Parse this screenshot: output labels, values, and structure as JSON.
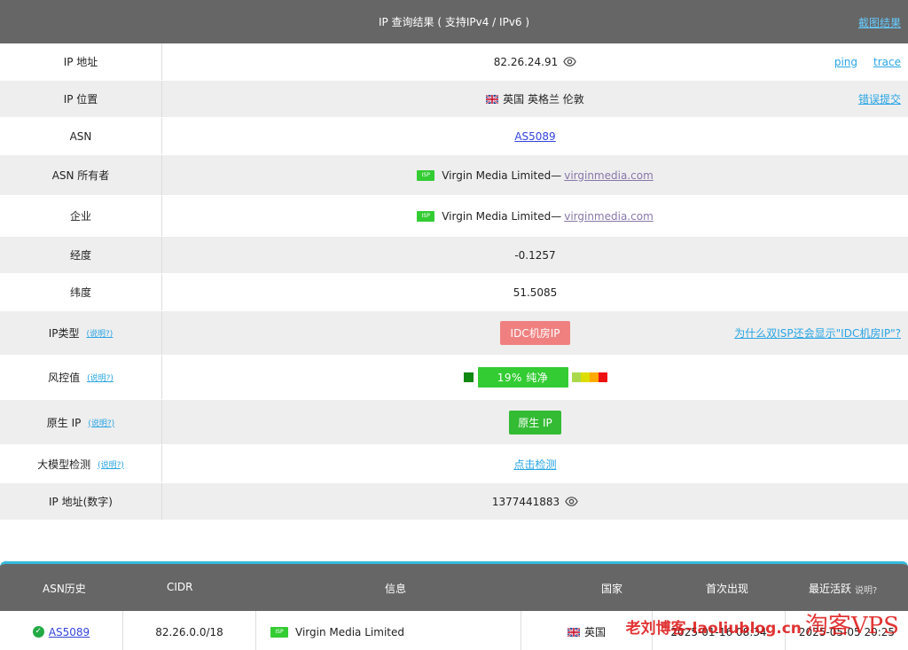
{
  "header": {
    "title": "IP 查询结果 ( 支持IPv4 / IPv6 )",
    "screenshot_link": "截图结果"
  },
  "rows": {
    "ip": {
      "label": "IP 地址",
      "value": "82.26.24.91",
      "ping": "ping",
      "trace": "trace"
    },
    "location": {
      "label": "IP 位置",
      "value": "英国 英格兰 伦敦",
      "report": "错误提交"
    },
    "asn": {
      "label": "ASN",
      "value": "AS5089"
    },
    "asn_owner": {
      "label": "ASN 所有者",
      "badge": "ISP",
      "name": "Virgin Media Limited—",
      "domain": "virginmedia.com"
    },
    "enterprise": {
      "label": "企业",
      "badge": "ISP",
      "name": "Virgin Media Limited—",
      "domain": "virginmedia.com"
    },
    "longitude": {
      "label": "经度",
      "value": "-0.1257"
    },
    "latitude": {
      "label": "纬度",
      "value": "51.5085"
    },
    "ip_type": {
      "label": "IP类型",
      "help": "(说明?)",
      "value": "IDC机房IP",
      "why": "为什么双ISP还会显示\"IDC机房IP\"?"
    },
    "risk": {
      "label": "风控值",
      "help": "(说明?)",
      "value": "19%  纯净",
      "percent": 19
    },
    "native": {
      "label": "原生 IP",
      "help": "(说明?)",
      "value": "原生 IP"
    },
    "llm": {
      "label": "大模型检测",
      "help": "(说明?)",
      "value": "点击检测"
    },
    "ip_numeric": {
      "label": "IP 地址(数字)",
      "value": "1377441883"
    }
  },
  "history": {
    "columns": {
      "asn": "ASN历史",
      "cidr": "CIDR",
      "info": "信息",
      "country": "国家",
      "first": "首次出现",
      "last": "最近活跃",
      "last_help": "说明?"
    },
    "row": {
      "asn": "AS5089",
      "cidr": "82.26.0.0/18",
      "badge": "ISP",
      "info": "Virgin Media Limited",
      "country": "英国",
      "first": "2025-01-16 08:34",
      "last": "2025-05-05 20:25"
    }
  },
  "watermark": {
    "text1": "老刘博客-laoliublog.cn",
    "text2": "淘客VPS"
  },
  "colors": {
    "accent_blue": "#29a5e4",
    "green": "#33cc33",
    "red_badge": "#f08080",
    "header_grey": "#666666"
  }
}
